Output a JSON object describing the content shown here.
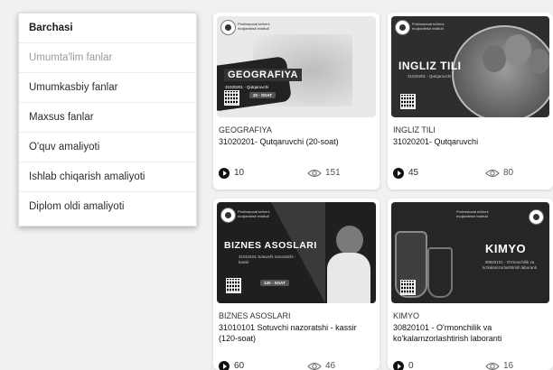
{
  "sidebar": {
    "items": [
      {
        "label": "Barchasi"
      },
      {
        "label": "Umumta'lim fanlar"
      },
      {
        "label": "Umumkasbiy fanlar"
      },
      {
        "label": "Maxsus fanlar"
      },
      {
        "label": "O'quv amaliyoti"
      },
      {
        "label": "Ishlab chiqarish amaliyoti"
      },
      {
        "label": "Diplom oldi amaliyoti"
      }
    ]
  },
  "cards": [
    {
      "category": "GEOGRAFIYA",
      "description": "31020201- Qutqaruvchi (20-soat)",
      "lessons": "10",
      "views": "151",
      "thumb": {
        "title": "GEOGRAFIYA",
        "subtitle": "31020201 - Qutqaruvchi",
        "hours": "20 - SOAT",
        "institute": "Professional ta'limni rivojlantirish instituti"
      }
    },
    {
      "category": "INGLIZ TILI",
      "description": "31020201- Qutqaruvchi",
      "lessons": "45",
      "views": "80",
      "thumb": {
        "title": "INGLIZ TILI",
        "subtitle": "31020201 - Qutqaruvchi",
        "institute": "Professional ta'limni rivojlantirish instituti"
      }
    },
    {
      "category": "BIZNES ASOSLARI",
      "description": "31010101 Sotuvchi nazoratshi - kassir (120-soat)",
      "lessons": "60",
      "views": "46",
      "thumb": {
        "title": "BIZNES ASOSLARI",
        "subtitle": "31010101 Sotuvchi nazoratchi - kassir",
        "hours": "120 - SOAT",
        "institute": "Professional ta'limni rivojlantirish instituti"
      }
    },
    {
      "category": "KIMYO",
      "description": "30820101 - O'rmonchilik va ko'kalamzorlashtirish laboranti",
      "lessons": "0",
      "views": "16",
      "thumb": {
        "title": "KIMYO",
        "subtitle": "30820101 - O'rmonchilik va ko'kalamzorlashtirish laboranti",
        "institute": "Professional ta'limni rivojlantirish instituti"
      }
    }
  ]
}
